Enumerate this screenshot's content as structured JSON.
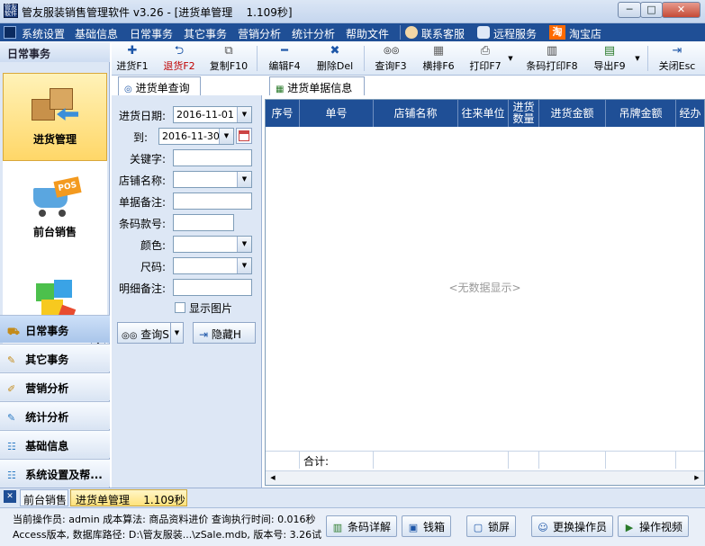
{
  "window": {
    "title": "管友服装销售管理软件 v3.26 - [进货单管理    1.109秒]",
    "icon_text": "管友软件",
    "minimize_glyph": "─",
    "maximize_glyph": "□",
    "close_glyph": "✕"
  },
  "menu": [
    "系统设置",
    "基础信息",
    "日常事务",
    "其它事务",
    "营销分析",
    "统计分析",
    "帮助文件",
    "联系客服",
    "远程服务",
    "淘宝店"
  ],
  "menu_icons": [
    "customer-service-icon",
    "remote-service-icon",
    "taobao-icon"
  ],
  "taobao_glyph": "淘",
  "toolbar": [
    {
      "label": "进货F1",
      "icon": "add-icon",
      "glyph": "✚",
      "color": "#1d56a8"
    },
    {
      "label": "退货F2",
      "icon": "return-icon",
      "glyph": "⮌",
      "color": "#1d56a8",
      "label_color": "#c00000"
    },
    {
      "label": "复制F10",
      "icon": "copy-icon",
      "glyph": "⧉",
      "color": "#555"
    },
    {
      "label": "编辑F4",
      "icon": "edit-icon",
      "glyph": "━",
      "color": "#1d56a8"
    },
    {
      "label": "删除Del",
      "icon": "delete-icon",
      "glyph": "✖",
      "color": "#1d56a8"
    },
    {
      "label": "查询F3",
      "icon": "binoculars-icon",
      "glyph": "◎◎",
      "color": "#111"
    },
    {
      "label": "横排F6",
      "icon": "grid-icon",
      "glyph": "▦",
      "color": "#666"
    },
    {
      "label": "打印F7",
      "icon": "printer-icon",
      "glyph": "⎙",
      "color": "#444"
    },
    {
      "label": "条码打印F8",
      "icon": "barcode-printer-icon",
      "glyph": "▥",
      "color": "#444"
    },
    {
      "label": "导出F9",
      "icon": "export-icon",
      "glyph": "▤",
      "color": "#2a7a2a"
    },
    {
      "label": "关闭Esc",
      "icon": "exit-icon",
      "glyph": "⇥",
      "color": "#1d56a8"
    }
  ],
  "dropdown_glyph": "▼",
  "nav": {
    "header": "日常事务",
    "big_items": [
      {
        "label": "进货管理",
        "icon": "stock-boxes-icon"
      },
      {
        "label": "前台销售",
        "icon": "pos-cart-icon"
      },
      {
        "label": "",
        "icon": "blocks-icon"
      }
    ],
    "expand_glyph": "⌄",
    "buttons": [
      {
        "label": "日常事务",
        "icon": "daily-icon",
        "glyph": "⛟"
      },
      {
        "label": "其它事务",
        "icon": "other-icon",
        "glyph": "✎"
      },
      {
        "label": "营销分析",
        "icon": "marketing-icon",
        "glyph": "✐"
      },
      {
        "label": "统计分析",
        "icon": "statistics-icon",
        "glyph": "✎"
      },
      {
        "label": "基础信息",
        "icon": "basic-info-icon",
        "glyph": "☷"
      },
      {
        "label": "系统设置及帮...",
        "icon": "settings-icon",
        "glyph": "☷"
      }
    ]
  },
  "query": {
    "tab_label": "进货单查询",
    "fields": {
      "date_from_label": "进货日期:",
      "date_from": "2016-11-01",
      "date_to_label": "到:",
      "date_to": "2016-11-30",
      "keyword_label": "关键字:",
      "shop_label": "店铺名称:",
      "note_label": "单据备注:",
      "barcode_label": "条码款号:",
      "color_label": "颜色:",
      "size_label": "尺码:",
      "detail_note_label": "明细备注:"
    },
    "show_image_label": "显示图片",
    "query_button": "查询S",
    "hide_button": "隐藏H"
  },
  "list": {
    "tab_label": "进货单据信息",
    "columns": [
      "序号",
      "单号",
      "店铺名称",
      "往来单位",
      "进货数量",
      "进货金额",
      "吊牌金额",
      "经办"
    ],
    "empty_text": "<无数据显示>",
    "total_label": "合计:"
  },
  "bottom_tabs": {
    "close_glyph": "✕",
    "tabs": [
      "前台销售",
      "进货单管理    1.109秒"
    ]
  },
  "status": {
    "line1": "当前操作员: admin  成本算法: 商品资料进价  查询执行时间: 0.016秒",
    "line2": "Access版本, 数据库路径: D:\\管友服装...\\zSale.mdb, 版本号: 3.26试",
    "buttons": [
      {
        "label": "条码详解",
        "icon": "barcode-icon",
        "glyph": "▥"
      },
      {
        "label": "钱箱",
        "icon": "cashbox-icon",
        "glyph": "▣"
      },
      {
        "label": "锁屏",
        "icon": "lock-icon",
        "glyph": "▢"
      },
      {
        "label": "更换操作员",
        "icon": "switch-user-icon",
        "glyph": "☺"
      },
      {
        "label": "操作视频",
        "icon": "video-icon",
        "glyph": "▶"
      }
    ]
  }
}
